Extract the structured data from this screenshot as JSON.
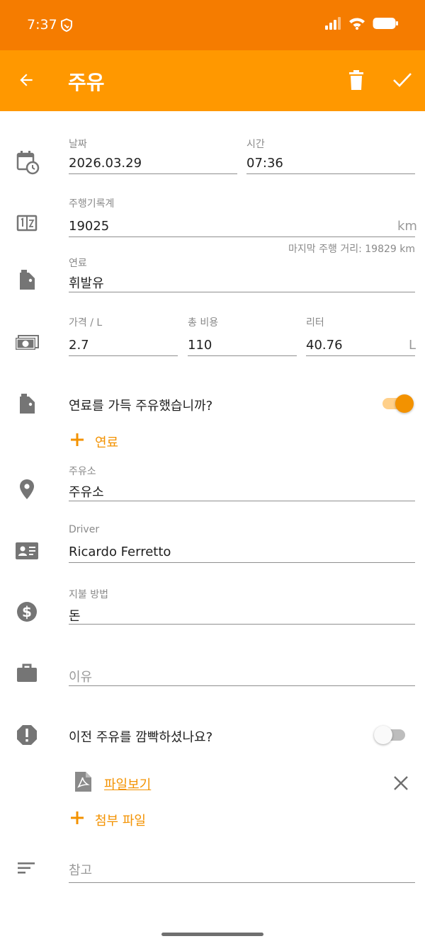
{
  "status_bar": {
    "time": "7:37"
  },
  "app_bar": {
    "title": "주유"
  },
  "date": {
    "label": "날짜",
    "value": "2026.03.29"
  },
  "time": {
    "label": "시간",
    "value": "07:36"
  },
  "odometer": {
    "label": "주행기록계",
    "value": "19025",
    "unit": "km",
    "hint": "마지막 주행 거리: 19829 km"
  },
  "fuel": {
    "label": "연료",
    "value": "휘발유"
  },
  "price": {
    "label": "가격 / L",
    "value": "2.7"
  },
  "total_cost": {
    "label": "총 비용",
    "value": "110"
  },
  "liters": {
    "label": "리터",
    "value": "40.76",
    "unit": "L"
  },
  "full_tank": {
    "question": "연료를 가득 주유했습니까?",
    "enabled": true
  },
  "add_fuel": {
    "label": "연료"
  },
  "station": {
    "label": "주유소",
    "value": "주유소"
  },
  "driver": {
    "label": "Driver",
    "value": "Ricardo Ferretto"
  },
  "payment": {
    "label": "지불 방법",
    "value": "돈"
  },
  "reason": {
    "placeholder": "이유"
  },
  "missed": {
    "question": "이전 주유를 깜빡하셨나요?",
    "enabled": false
  },
  "attachment": {
    "file_label": "파일보기",
    "add_label": "첨부 파일"
  },
  "notes": {
    "placeholder": "참고"
  },
  "colors": {
    "primary": "#ff9800",
    "status_bar": "#f57c00",
    "accent": "#f39200",
    "icon_gray": "#757575"
  }
}
